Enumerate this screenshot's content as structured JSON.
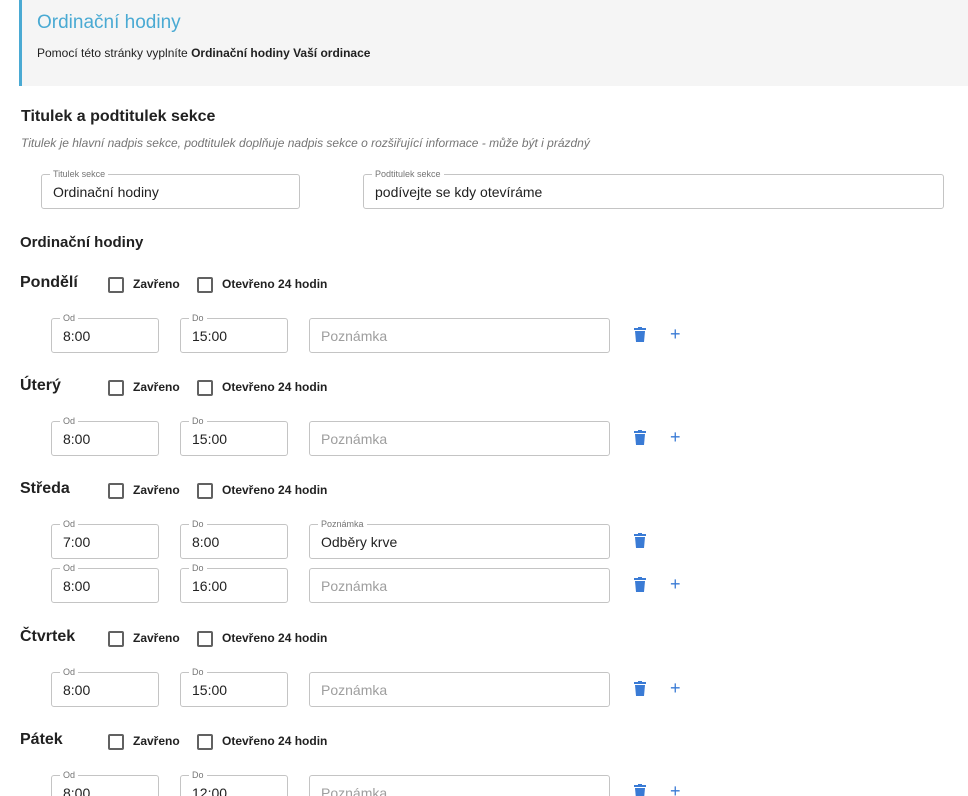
{
  "header": {
    "title": "Ordinační hodiny",
    "desc_prefix": "Pomocí této stránky vyplníte ",
    "desc_bold": "Ordinační hodiny Vaší ordinace"
  },
  "section": {
    "title": "Titulek a podtitulek sekce",
    "desc": "Titulek je hlavní nadpis sekce, podtitulek doplňuje nadpis sekce o rozšiřující informace - může být i prázdný",
    "title_field_label": "Titulek sekce",
    "title_field_value": "Ordinační hodiny",
    "subtitle_field_label": "Podtitulek sekce",
    "subtitle_field_value": "podívejte se kdy otevíráme"
  },
  "hours": {
    "title": "Ordinační hodiny",
    "closed_label": "Zavřeno",
    "open24_label": "Otevřeno 24 hodin",
    "from_label": "Od",
    "to_label": "Do",
    "note_label": "Poznámka",
    "note_placeholder": "Poznámka",
    "days": [
      {
        "name": "Pondělí",
        "closed": false,
        "open24": false,
        "slots": [
          {
            "from": "8:00",
            "to": "15:00",
            "note": ""
          }
        ]
      },
      {
        "name": "Úterý",
        "closed": false,
        "open24": false,
        "slots": [
          {
            "from": "8:00",
            "to": "15:00",
            "note": ""
          }
        ]
      },
      {
        "name": "Středa",
        "closed": false,
        "open24": false,
        "slots": [
          {
            "from": "7:00",
            "to": "8:00",
            "note": "Odběry krve"
          },
          {
            "from": "8:00",
            "to": "16:00",
            "note": ""
          }
        ]
      },
      {
        "name": "Čtvrtek",
        "closed": false,
        "open24": false,
        "slots": [
          {
            "from": "8:00",
            "to": "15:00",
            "note": ""
          }
        ]
      },
      {
        "name": "Pátek",
        "closed": false,
        "open24": false,
        "slots": [
          {
            "from": "8:00",
            "to": "12:00",
            "note": ""
          }
        ]
      }
    ]
  },
  "icons": {
    "delete": "trash-icon",
    "add": "plus-icon",
    "plus_glyph": "+"
  },
  "colors": {
    "accent": "#4aaad3",
    "icon_blue": "#3a7bd5"
  }
}
